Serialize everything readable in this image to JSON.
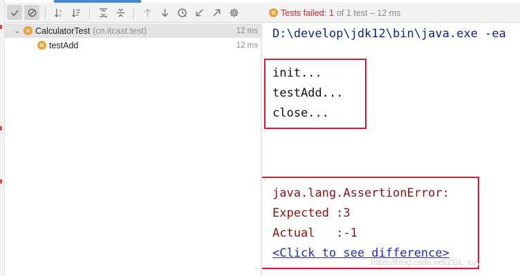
{
  "toolbar": {
    "buttons": [
      {
        "icon": "check-icon",
        "toggled": true
      },
      {
        "icon": "cancel-circle-icon",
        "toggled": true
      },
      {
        "icon": "sort-alpha-icon"
      },
      {
        "icon": "sort-duration-icon"
      },
      {
        "icon": "expand-all-icon"
      },
      {
        "icon": "collapse-all-icon"
      },
      {
        "icon": "arrow-up-icon",
        "disabled": true
      },
      {
        "icon": "arrow-down-icon"
      },
      {
        "icon": "history-clock-icon"
      },
      {
        "icon": "import-arrow-icon"
      },
      {
        "icon": "export-arrow-icon"
      },
      {
        "icon": "gear-icon"
      }
    ]
  },
  "status": {
    "failed_label": "Tests failed:",
    "count": "1",
    "rest": "of 1 test – 12 ms"
  },
  "tree": {
    "items": [
      {
        "name": "CalculatorTest",
        "package": "(cn.itcast.test)",
        "time": "12 ms",
        "selected": true
      },
      {
        "name": "testAdd",
        "package": "",
        "time": "12 ms",
        "selected": false
      }
    ]
  },
  "console": {
    "command": "D:\\develop\\jdk12\\bin\\java.exe -ea",
    "output": [
      "init...",
      "testAdd...",
      "close..."
    ],
    "error_lines": [
      "java.lang.AssertionError:",
      "Expected :3",
      "Actual   :-1"
    ],
    "diff_link": "<Click to see difference>"
  },
  "watermark": "https://blog.csdn.net/ZGL_cyy",
  "colors": {
    "failed": "#c7222d",
    "error_text": "#8b1010",
    "link": "#2525c9",
    "highlight_box": "#e8112d",
    "warning_dot": "#e8a33c"
  }
}
